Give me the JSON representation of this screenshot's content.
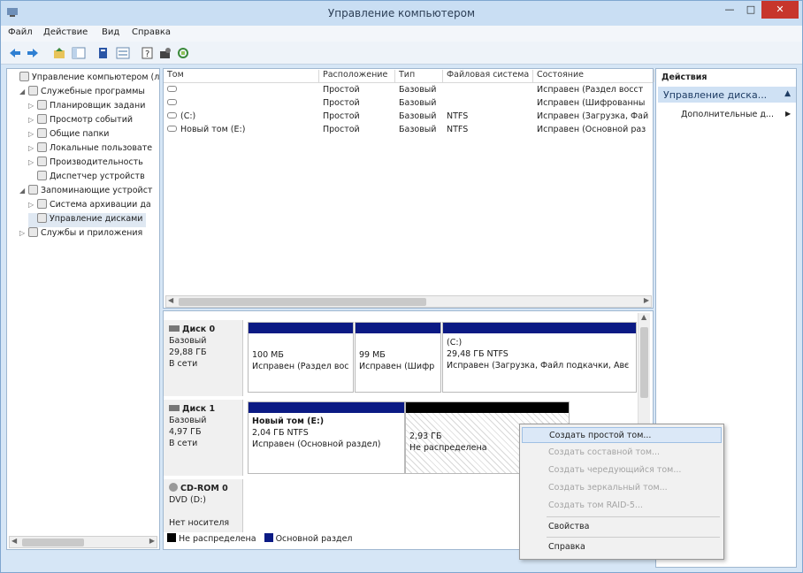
{
  "window": {
    "title": "Управление компьютером"
  },
  "menu": [
    "Файл",
    "Действие",
    "Вид",
    "Справка"
  ],
  "toolbar": {
    "icons": [
      "back-arrow-icon",
      "forward-arrow-icon",
      "up-folder-icon",
      "show-hide-tree-icon",
      "properties-icon",
      "help-icon",
      "refresh-icon",
      "export-icon",
      "settings-icon"
    ]
  },
  "tree": [
    {
      "label": "Управление компьютером (л",
      "level": 0,
      "arrow": "",
      "icon": "computer-management-icon"
    },
    {
      "label": "Служебные программы",
      "level": 1,
      "arrow": "◢",
      "icon": "tools-icon"
    },
    {
      "label": "Планировщик задани",
      "level": 2,
      "arrow": "▷",
      "icon": "scheduler-icon"
    },
    {
      "label": "Просмотр событий",
      "level": 2,
      "arrow": "▷",
      "icon": "event-viewer-icon"
    },
    {
      "label": "Общие папки",
      "level": 2,
      "arrow": "▷",
      "icon": "shared-folders-icon"
    },
    {
      "label": "Локальные пользовате",
      "level": 2,
      "arrow": "▷",
      "icon": "users-icon"
    },
    {
      "label": "Производительность",
      "level": 2,
      "arrow": "▷",
      "icon": "performance-icon"
    },
    {
      "label": "Диспетчер устройств",
      "level": 2,
      "arrow": "",
      "icon": "device-manager-icon"
    },
    {
      "label": "Запоминающие устройст",
      "level": 1,
      "arrow": "◢",
      "icon": "storage-icon"
    },
    {
      "label": "Система архивации да",
      "level": 2,
      "arrow": "▷",
      "icon": "backup-icon"
    },
    {
      "label": "Управление дисками",
      "level": 2,
      "arrow": "",
      "icon": "disk-management-icon",
      "selected": true
    },
    {
      "label": "Службы и приложения",
      "level": 1,
      "arrow": "▷",
      "icon": "services-icon"
    }
  ],
  "volume_table": {
    "columns": [
      "Том",
      "Расположение",
      "Тип",
      "Файловая система",
      "Состояние"
    ],
    "rows": [
      [
        "",
        "Простой",
        "Базовый",
        "",
        "Исправен (Раздел восст"
      ],
      [
        "",
        "Простой",
        "Базовый",
        "",
        "Исправен (Шифрованны"
      ],
      [
        "(C:)",
        "Простой",
        "Базовый",
        "NTFS",
        "Исправен (Загрузка, Фай"
      ],
      [
        "Новый том (E:)",
        "Простой",
        "Базовый",
        "NTFS",
        "Исправен (Основной раз"
      ]
    ]
  },
  "disks": [
    {
      "name": "Диск 0",
      "type": "Базовый",
      "size": "29,88 ГБ",
      "status": "В сети",
      "partitions": [
        {
          "line1": "",
          "line2": "100 МБ",
          "line3": "Исправен (Раздел вос",
          "bar": "#0b1a84"
        },
        {
          "line1": "",
          "line2": "99 МБ",
          "line3": "Исправен (Шифр",
          "bar": "#0b1a84"
        },
        {
          "line1": "(C:)",
          "line2": "29,48 ГБ NTFS",
          "line3": "Исправен (Загрузка, Файл подкачки, Авє",
          "bar": "#0b1a84"
        }
      ]
    },
    {
      "name": "Диск 1",
      "type": "Базовый",
      "size": "4,97 ГБ",
      "status": "В сети",
      "partitions": [
        {
          "line1": "Новый том (E:)",
          "line2": "2,04 ГБ NTFS",
          "line3": "Исправен (Основной раздел)",
          "bar": "#0b1a84"
        },
        {
          "line1": "",
          "line2": "2,93 ГБ",
          "line3": "Не распределена",
          "bar": "#000000",
          "hatch": true
        }
      ]
    },
    {
      "name": "CD-ROM 0",
      "type": "DVD (D:)",
      "size": "",
      "status": "Нет носителя"
    }
  ],
  "legend": [
    {
      "label": "Не распределена",
      "color": "#000000"
    },
    {
      "label": "Основной раздел",
      "color": "#0b1a84"
    }
  ],
  "actions": {
    "header": "Действия",
    "section": "Управление диска...",
    "item": "Дополнительные д..."
  },
  "context_menu": [
    {
      "label": "Создать простой том...",
      "state": "highlighted"
    },
    {
      "label": "Создать составной том...",
      "state": "disabled"
    },
    {
      "label": "Создать чередующийся том...",
      "state": "disabled"
    },
    {
      "label": "Создать зеркальный том...",
      "state": "disabled"
    },
    {
      "label": "Создать том RAID-5...",
      "state": "disabled"
    },
    {
      "label": "Свойства",
      "state": "enabled"
    },
    {
      "label": "Справка",
      "state": "enabled"
    }
  ]
}
